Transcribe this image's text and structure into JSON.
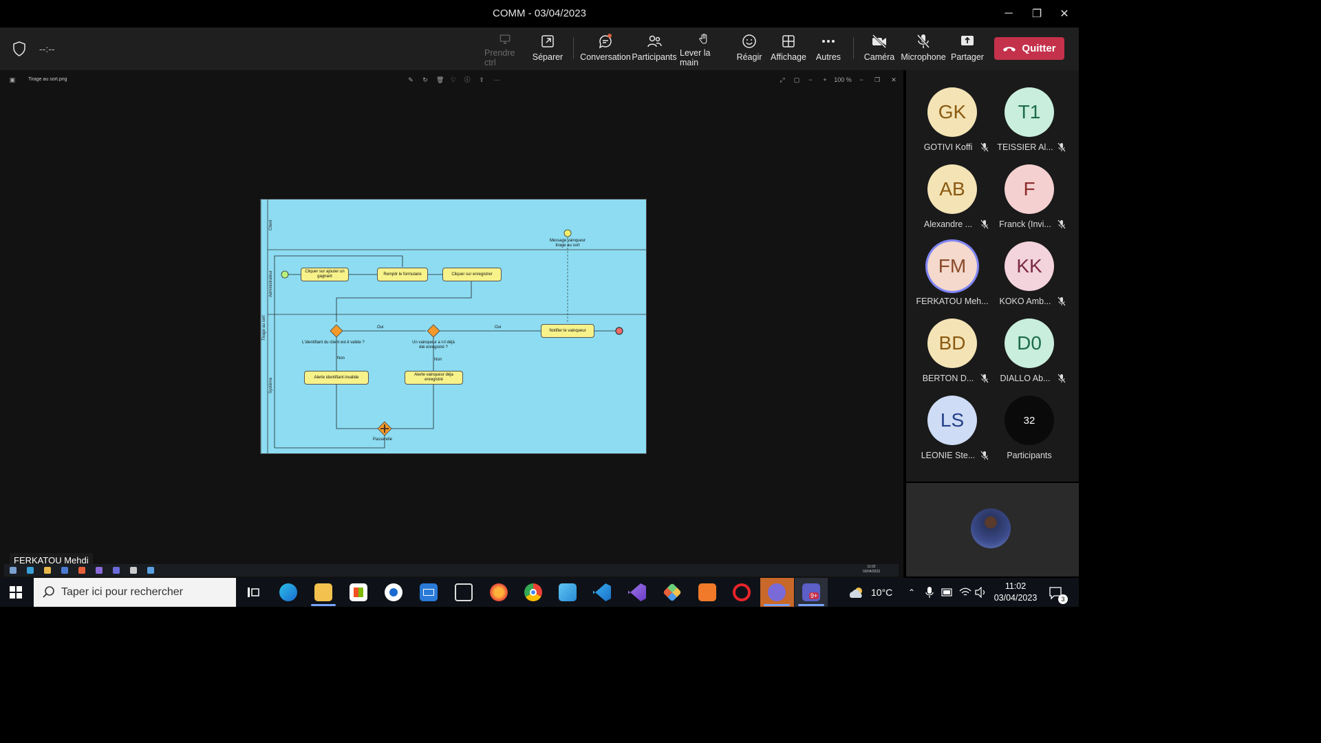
{
  "window": {
    "title": "COMM - 03/04/2023",
    "minimize": "─",
    "restore": "❐",
    "close": "✕"
  },
  "meeting": {
    "timer": "--:--"
  },
  "toolbar": {
    "take_control": "Prendre ctrl",
    "separate": "Séparer",
    "conversation": "Conversation",
    "participants": "Participants",
    "raise_hand": "Lever la main",
    "react": "Réagir",
    "view": "Affichage",
    "more": "Autres",
    "camera": "Caméra",
    "microphone": "Microphone",
    "share": "Partager",
    "quit": "Quitter",
    "accent_color": "#c4314b"
  },
  "viewer": {
    "filename": "Tirage au sort.png",
    "zoom": "100 %",
    "more": "···"
  },
  "diagram": {
    "lanes": {
      "pool": "Tirage au sort",
      "client": "Client",
      "admin": "Administrateur",
      "system": "Système"
    },
    "tasks": {
      "t1": "Cliquer sur ajouter un gagnant",
      "t2": "Remplir le formulaire",
      "t3": "Cliquer sur enregistrer",
      "t4": "Notifier le vainqueur",
      "t5": "Alerte identifiant invalide",
      "t6": "Alerte vainqueur déja enregistré"
    },
    "gateway1": "L'identifiant du client est-il valide ?",
    "gateway2": "Un vainqueur a t-il déjà été enregistré ?",
    "message": "Message vainqueur tirage au sort",
    "join": "Passerelle",
    "oui1": "Oui",
    "oui2": "Oui",
    "non1": "Non",
    "non2": "Non"
  },
  "presenter": {
    "name": "FERKATOU Mehdi"
  },
  "participants": [
    {
      "initials": "GK",
      "name": "GOTIVI Koffi",
      "bg": "#f4e3b5",
      "fg": "#8a5a12",
      "muted": true
    },
    {
      "initials": "T1",
      "name": "TEISSIER Al...",
      "bg": "#c9eedd",
      "fg": "#1d6b4a",
      "muted": true
    },
    {
      "initials": "AB",
      "name": "Alexandre ...",
      "bg": "#f4e3b5",
      "fg": "#8a5a12",
      "muted": true
    },
    {
      "initials": "F",
      "name": "Franck (Invi...",
      "bg": "#f5d0d0",
      "fg": "#8a2a2a",
      "muted": true
    },
    {
      "initials": "FM",
      "name": "FERKATOU Meh...",
      "bg": "#f4d9cc",
      "fg": "#8a4a2a",
      "muted": false
    },
    {
      "initials": "KK",
      "name": "KOKO Amb...",
      "bg": "#f3d3dc",
      "fg": "#7a2a45",
      "muted": true
    },
    {
      "initials": "BD",
      "name": "BERTON D...",
      "bg": "#f4e3b5",
      "fg": "#8a5a12",
      "muted": true
    },
    {
      "initials": "D0",
      "name": "DIALLO Ab...",
      "bg": "#c9eedd",
      "fg": "#1d6b4a",
      "muted": true
    },
    {
      "initials": "LS",
      "name": "LEONIE Ste...",
      "bg": "#cfdcf5",
      "fg": "#24408a",
      "muted": true
    }
  ],
  "participants_more": {
    "count": "32",
    "label": "Participants"
  },
  "taskbar": {
    "search_placeholder": "Taper ici pour rechercher",
    "temperature": "10°C",
    "time": "11:02",
    "date": "03/04/2023",
    "notif_count": "3",
    "teams_badge": "9+",
    "mini_time": "11:02",
    "mini_date": "03/04/2023"
  }
}
